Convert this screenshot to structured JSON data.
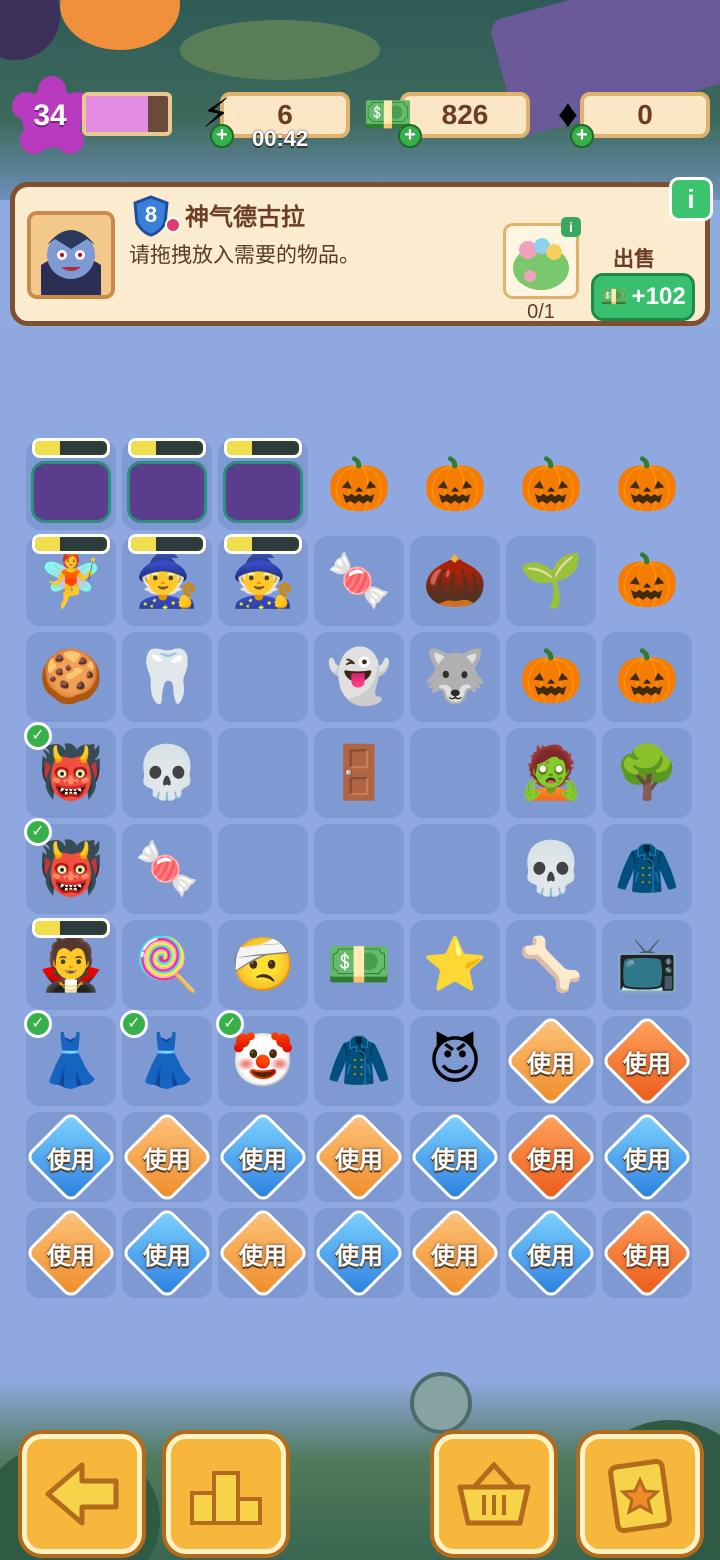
{
  "hud": {
    "level": "34",
    "xp_fraction": 0.75,
    "energy": "6",
    "energy_timer": "00:42",
    "cash": "826",
    "gems": "0"
  },
  "order": {
    "shield_level": "8",
    "character_name": "神气德古拉",
    "instruction": "请拖拽放入需要的物品。",
    "required_progress": "0/1",
    "sell_label": "出售",
    "sell_reward": "+102",
    "info_label": "i",
    "req_info_label": "i"
  },
  "board": {
    "use_label": "使用",
    "rows": [
      [
        {
          "kind": "generator",
          "name": "monster-generator",
          "progress": 0.35
        },
        {
          "kind": "generator",
          "name": "monster-generator",
          "progress": 0.35
        },
        {
          "kind": "generator",
          "name": "monster-generator",
          "progress": 0.35
        },
        {
          "kind": "pumpkin-field",
          "icon": "🎃"
        },
        {
          "kind": "pumpkin-field",
          "icon": "🎃"
        },
        {
          "kind": "pumpkin-field",
          "icon": "🎃"
        },
        {
          "kind": "pumpkin-field",
          "icon": "🎃"
        }
      ],
      [
        {
          "kind": "generator",
          "name": "fairy-girl",
          "icon": "🧚",
          "progress": 0.35
        },
        {
          "kind": "generator",
          "name": "witch-girl",
          "icon": "🧙",
          "progress": 0.35
        },
        {
          "kind": "generator",
          "name": "witch-girl",
          "icon": "🧙",
          "progress": 0.35
        },
        {
          "kind": "item",
          "name": "candy",
          "icon": "🍬"
        },
        {
          "kind": "item",
          "name": "seeds",
          "icon": "🌰"
        },
        {
          "kind": "item",
          "name": "sprout",
          "icon": "🌱"
        },
        {
          "kind": "pumpkin-field",
          "icon": "🎃"
        }
      ],
      [
        {
          "kind": "item",
          "name": "cookie",
          "icon": "🍪"
        },
        {
          "kind": "item",
          "name": "tooth",
          "icon": "🦷"
        },
        {
          "kind": "empty"
        },
        {
          "kind": "item",
          "name": "ghost",
          "icon": "👻"
        },
        {
          "kind": "item",
          "name": "werewolf",
          "icon": "🐺"
        },
        {
          "kind": "item",
          "name": "small-pumpkin",
          "icon": "🎃"
        },
        {
          "kind": "item",
          "name": "jack-o-lantern",
          "icon": "🎃"
        }
      ],
      [
        {
          "kind": "item",
          "name": "devil",
          "icon": "👹",
          "check": true
        },
        {
          "kind": "item",
          "name": "skull-lollipop",
          "icon": "💀"
        },
        {
          "kind": "empty"
        },
        {
          "kind": "item",
          "name": "haunted-closet",
          "icon": "🚪"
        },
        {
          "kind": "empty"
        },
        {
          "kind": "item",
          "name": "zombie-head",
          "icon": "🧟"
        },
        {
          "kind": "item",
          "name": "haunted-tree",
          "icon": "🌳"
        }
      ],
      [
        {
          "kind": "item",
          "name": "devil",
          "icon": "👹",
          "check": true
        },
        {
          "kind": "item",
          "name": "candy-bag",
          "icon": "🍬"
        },
        {
          "kind": "empty"
        },
        {
          "kind": "empty"
        },
        {
          "kind": "empty"
        },
        {
          "kind": "item",
          "name": "grim-reaper",
          "icon": "💀"
        },
        {
          "kind": "item",
          "name": "star-cape",
          "icon": "🧥"
        }
      ],
      [
        {
          "kind": "generator",
          "name": "dracula",
          "icon": "🧛",
          "progress": 0.35
        },
        {
          "kind": "item",
          "name": "candy-pile",
          "icon": "🍭"
        },
        {
          "kind": "item",
          "name": "mummy-head",
          "icon": "🤕"
        },
        {
          "kind": "item",
          "name": "cash-stack",
          "icon": "💵"
        },
        {
          "kind": "item",
          "name": "purple-star",
          "icon": "⭐"
        },
        {
          "kind": "item",
          "name": "skeleton-costume",
          "icon": "🦴"
        },
        {
          "kind": "item",
          "name": "haunted-tv",
          "icon": "📺"
        }
      ],
      [
        {
          "kind": "item",
          "name": "red-dress",
          "icon": "👗",
          "check": true
        },
        {
          "kind": "item",
          "name": "red-dress",
          "icon": "👗",
          "check": true
        },
        {
          "kind": "item",
          "name": "clown-outfit",
          "icon": "🤡",
          "check": true
        },
        {
          "kind": "item",
          "name": "star-cape",
          "icon": "🧥"
        },
        {
          "kind": "item",
          "name": "imp",
          "icon": "😈"
        },
        {
          "kind": "use",
          "color": "orange"
        },
        {
          "kind": "use",
          "color": "red"
        }
      ],
      [
        {
          "kind": "use",
          "color": "blue"
        },
        {
          "kind": "use",
          "color": "orange"
        },
        {
          "kind": "use",
          "color": "blue"
        },
        {
          "kind": "use",
          "color": "orange"
        },
        {
          "kind": "use",
          "color": "blue"
        },
        {
          "kind": "use",
          "color": "red"
        },
        {
          "kind": "use",
          "color": "blue"
        }
      ],
      [
        {
          "kind": "use",
          "color": "orange"
        },
        {
          "kind": "use",
          "color": "blue"
        },
        {
          "kind": "use",
          "color": "orange"
        },
        {
          "kind": "use",
          "color": "blue"
        },
        {
          "kind": "use",
          "color": "orange"
        },
        {
          "kind": "use",
          "color": "blue"
        },
        {
          "kind": "use",
          "color": "red"
        }
      ]
    ]
  },
  "nav": [
    {
      "name": "back-button",
      "icon": "arrow-left-icon"
    },
    {
      "name": "leaderboard-button",
      "icon": "podium-icon"
    },
    {
      "name": "shop-button",
      "icon": "basket-icon"
    },
    {
      "name": "tasks-button",
      "icon": "clipboard-star-icon"
    }
  ],
  "colors": {
    "board": "#8fa9e0",
    "cell": "#7f9ad3",
    "accent_green": "#39c06f",
    "card_border": "#7d5032"
  }
}
